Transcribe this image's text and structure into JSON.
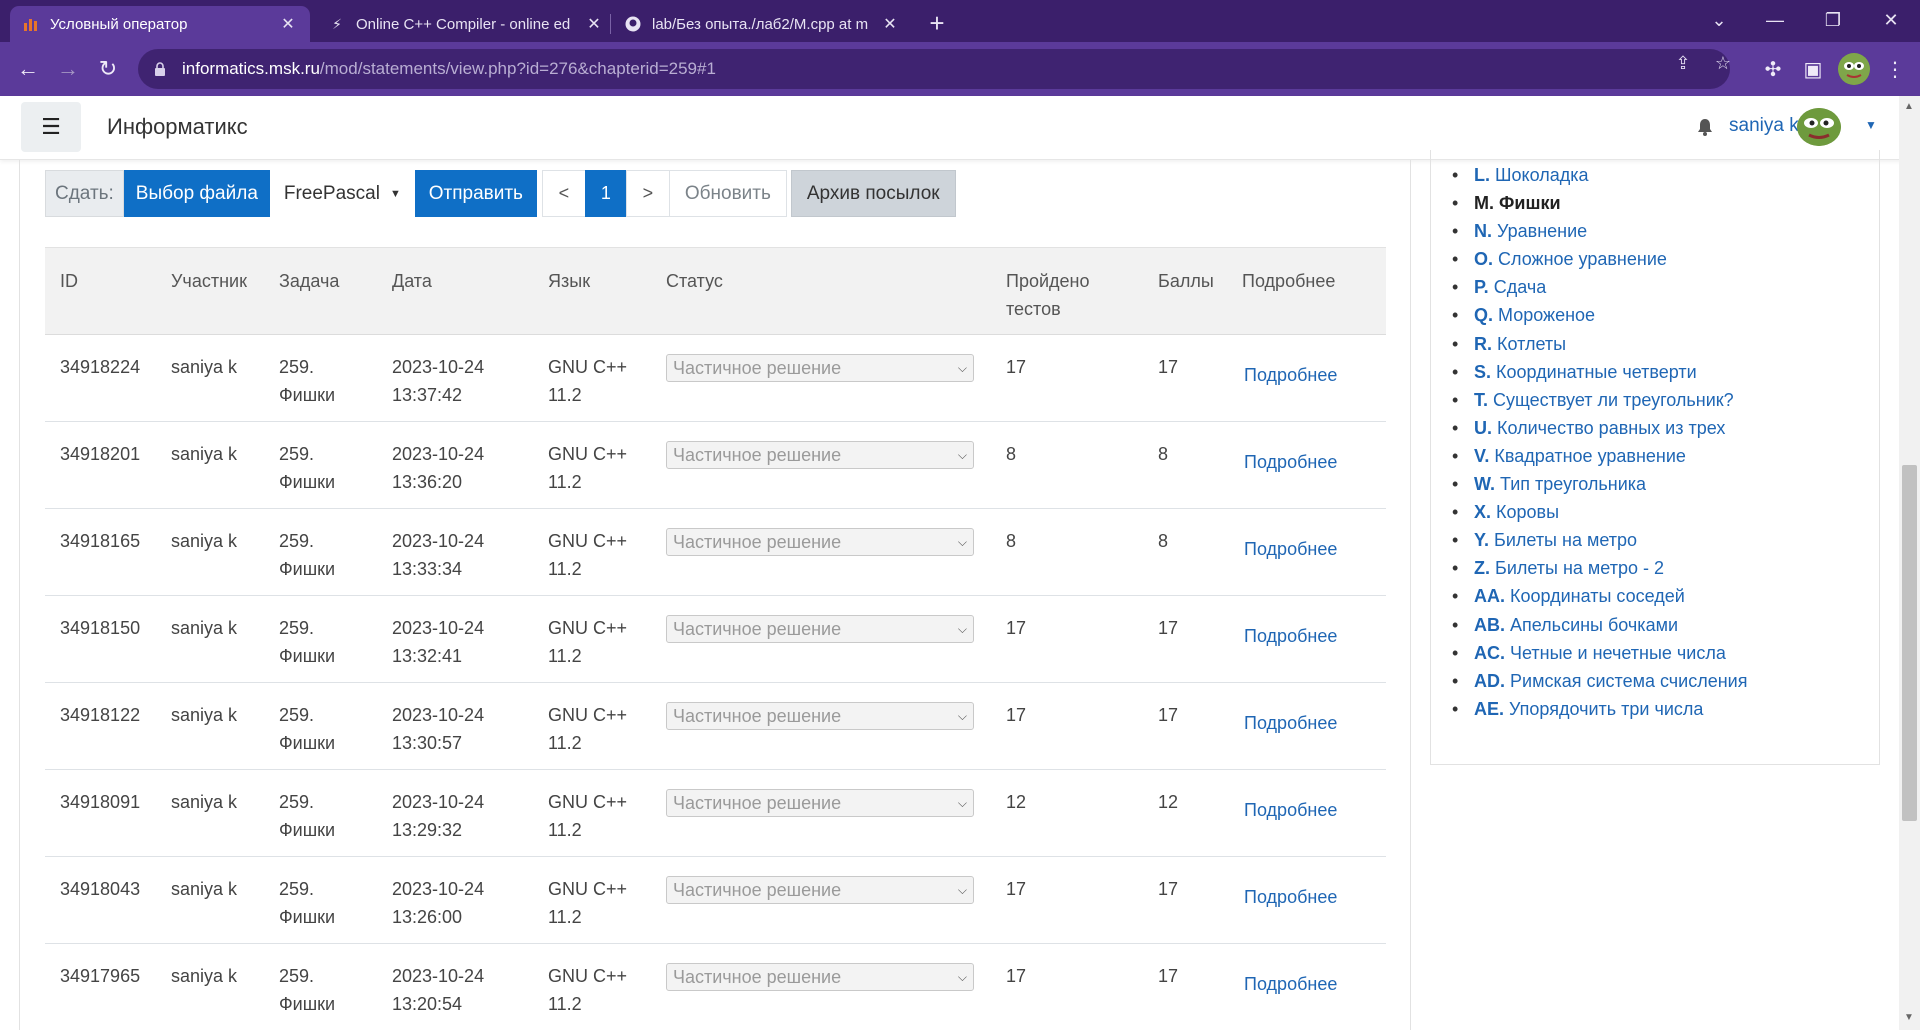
{
  "browser": {
    "tabs": [
      {
        "title": "Условный оператор",
        "icon": "informatics-favicon",
        "active": true
      },
      {
        "title": "Online C++ Compiler - online ed",
        "icon": "bolt-favicon",
        "active": false
      },
      {
        "title": "lab/Без опыта./лаб2/M.cpp at m",
        "icon": "github-favicon",
        "active": false
      }
    ],
    "url_host": "informatics.msk.ru",
    "url_path": "/mod/statements/view.php?id=276&chapterid=259#1"
  },
  "header": {
    "site_name": "Информатикс",
    "username": "saniya k"
  },
  "submit_bar": {
    "label": "Сдать:",
    "choose_file": "Выбор файла",
    "language": "FreePascal",
    "send": "Отправить",
    "prev": "<",
    "page": "1",
    "next": ">",
    "refresh": "Обновить",
    "archive": "Архив посылок"
  },
  "table": {
    "headers": {
      "id": "ID",
      "user": "Участник",
      "problem": "Задача",
      "date": "Дата",
      "lang": "Язык",
      "status": "Статус",
      "tests_1": "Пройдено",
      "tests_2": "тестов",
      "score": "Баллы",
      "details": "Подробнее"
    },
    "rows": [
      {
        "id": "34918224",
        "user": "saniya k",
        "problem_num": "259.",
        "problem_name": "Фишки",
        "date": "2023-10-24",
        "time": "13:37:42",
        "lang_1": "GNU C++",
        "lang_2": "11.2",
        "status": "Частичное решение",
        "tests": "17",
        "score": "17",
        "details": "Подробнее"
      },
      {
        "id": "34918201",
        "user": "saniya k",
        "problem_num": "259.",
        "problem_name": "Фишки",
        "date": "2023-10-24",
        "time": "13:36:20",
        "lang_1": "GNU C++",
        "lang_2": "11.2",
        "status": "Частичное решение",
        "tests": "8",
        "score": "8",
        "details": "Подробнее"
      },
      {
        "id": "34918165",
        "user": "saniya k",
        "problem_num": "259.",
        "problem_name": "Фишки",
        "date": "2023-10-24",
        "time": "13:33:34",
        "lang_1": "GNU C++",
        "lang_2": "11.2",
        "status": "Частичное решение",
        "tests": "8",
        "score": "8",
        "details": "Подробнее"
      },
      {
        "id": "34918150",
        "user": "saniya k",
        "problem_num": "259.",
        "problem_name": "Фишки",
        "date": "2023-10-24",
        "time": "13:32:41",
        "lang_1": "GNU C++",
        "lang_2": "11.2",
        "status": "Частичное решение",
        "tests": "17",
        "score": "17",
        "details": "Подробнее"
      },
      {
        "id": "34918122",
        "user": "saniya k",
        "problem_num": "259.",
        "problem_name": "Фишки",
        "date": "2023-10-24",
        "time": "13:30:57",
        "lang_1": "GNU C++",
        "lang_2": "11.2",
        "status": "Частичное решение",
        "tests": "17",
        "score": "17",
        "details": "Подробнее"
      },
      {
        "id": "34918091",
        "user": "saniya k",
        "problem_num": "259.",
        "problem_name": "Фишки",
        "date": "2023-10-24",
        "time": "13:29:32",
        "lang_1": "GNU C++",
        "lang_2": "11.2",
        "status": "Частичное решение",
        "tests": "12",
        "score": "12",
        "details": "Подробнее"
      },
      {
        "id": "34918043",
        "user": "saniya k",
        "problem_num": "259.",
        "problem_name": "Фишки",
        "date": "2023-10-24",
        "time": "13:26:00",
        "lang_1": "GNU C++",
        "lang_2": "11.2",
        "status": "Частичное решение",
        "tests": "17",
        "score": "17",
        "details": "Подробнее"
      },
      {
        "id": "34917965",
        "user": "saniya k",
        "problem_num": "259.",
        "problem_name": "Фишки",
        "date": "2023-10-24",
        "time": "13:20:54",
        "lang_1": "GNU C++",
        "lang_2": "11.2",
        "status": "Частичное решение",
        "tests": "17",
        "score": "17",
        "details": "Подробнее"
      }
    ]
  },
  "problems": [
    {
      "code": "L.",
      "name": "Шоколадка",
      "current": false
    },
    {
      "code": "M.",
      "name": "Фишки",
      "current": true
    },
    {
      "code": "N.",
      "name": "Уравнение",
      "current": false
    },
    {
      "code": "O.",
      "name": "Сложное уравнение",
      "current": false
    },
    {
      "code": "P.",
      "name": "Сдача",
      "current": false
    },
    {
      "code": "Q.",
      "name": "Мороженое",
      "current": false
    },
    {
      "code": "R.",
      "name": "Котлеты",
      "current": false
    },
    {
      "code": "S.",
      "name": "Координатные четверти",
      "current": false
    },
    {
      "code": "T.",
      "name": "Существует ли треугольник?",
      "current": false
    },
    {
      "code": "U.",
      "name": "Количество равных из трех",
      "current": false
    },
    {
      "code": "V.",
      "name": "Квадратное уравнение",
      "current": false
    },
    {
      "code": "W.",
      "name": "Тип треугольника",
      "current": false
    },
    {
      "code": "X.",
      "name": "Коровы",
      "current": false
    },
    {
      "code": "Y.",
      "name": "Билеты на метро",
      "current": false
    },
    {
      "code": "Z.",
      "name": "Билеты на метро - 2",
      "current": false
    },
    {
      "code": "AA.",
      "name": "Координаты соседей",
      "current": false
    },
    {
      "code": "AB.",
      "name": "Апельсины бочками",
      "current": false
    },
    {
      "code": "AC.",
      "name": "Четные и нечетные числа",
      "current": false
    },
    {
      "code": "AD.",
      "name": "Римская система счисления",
      "current": false
    },
    {
      "code": "AE.",
      "name": "Упорядочить три числа",
      "current": false
    }
  ],
  "colors": {
    "primary": "#0f6fc6",
    "link": "#1f66b4",
    "browser_frame": "#3b1f6b",
    "browser_toolbar": "#5b3a9a"
  }
}
